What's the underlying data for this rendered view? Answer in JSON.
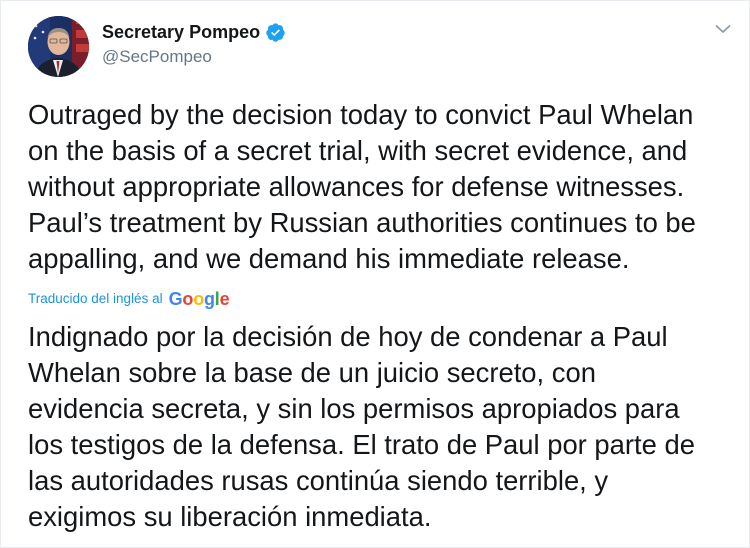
{
  "tweet": {
    "display_name": "Secretary Pompeo",
    "handle": "@SecPompeo",
    "verified_icon": "verified-badge-icon",
    "menu_icon": "chevron-down-icon",
    "text": "Outraged by the decision today to convict Paul Whelan\non the basis of a secret trial, with secret evidence, and\nwithout appropriate allowances for defense witnesses.\nPaul’s treatment by Russian authorities continues to be\nappalling, and we demand his immediate release.",
    "translated_label": "Traducido del inglés al",
    "translation_provider": {
      "G": "G",
      "o1": "o",
      "o2": "o",
      "g": "g",
      "l": "l",
      "e": "e"
    },
    "translation": "Indignado por la decisión de hoy de condenar a Paul\nWhelan sobre la base de un juicio secreto, con\nevidencia secreta, y sin los permisos apropiados para\nlos testigos de la defensa. El trato de Paul por parte de\nlas autoridades rusas continúa siendo terrible, y\nexigimos su liberación inmediata."
  },
  "colors": {
    "link_blue": "#1b95e0",
    "verified_blue": "#1da1f2",
    "secondary_text": "#657786"
  }
}
